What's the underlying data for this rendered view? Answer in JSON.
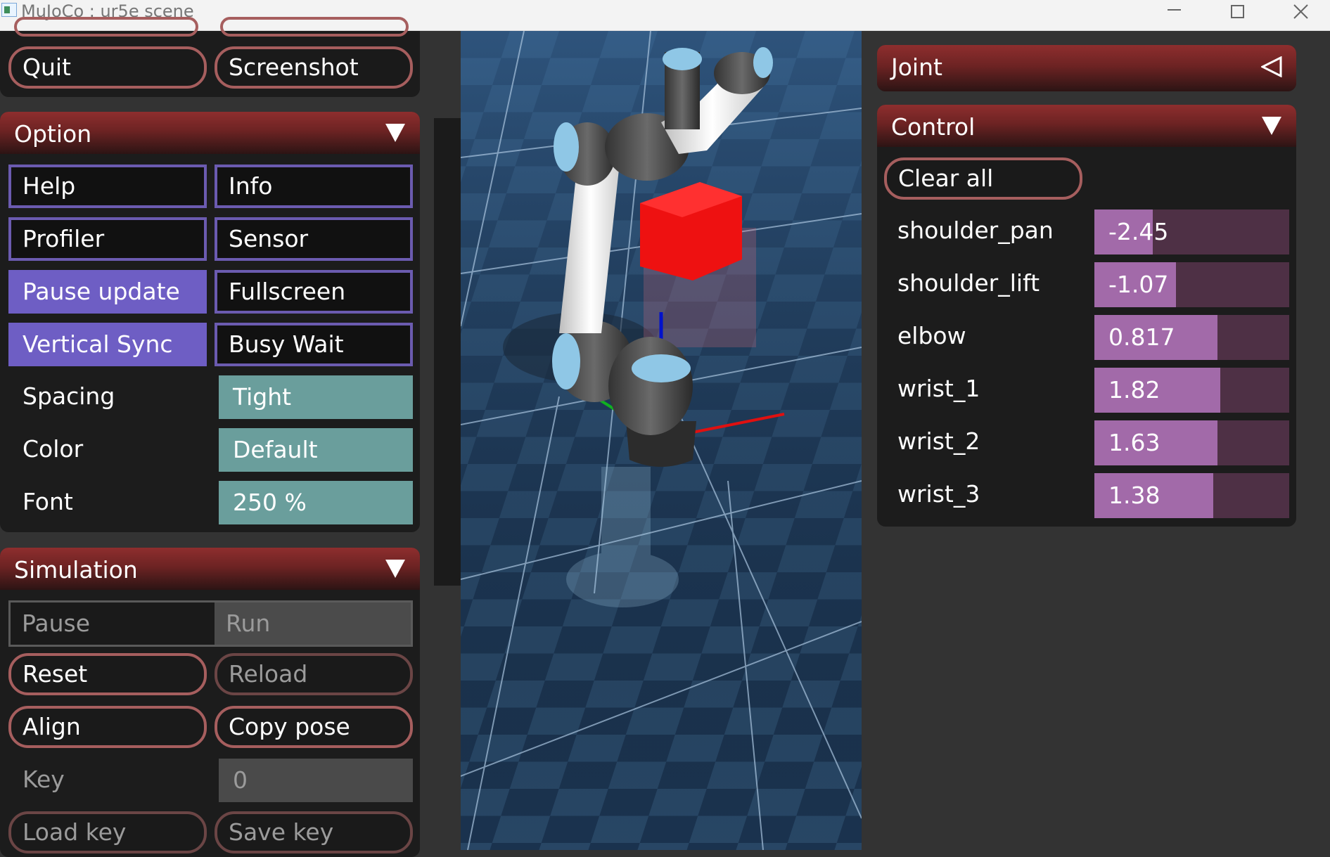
{
  "window": {
    "title": "MuJoCo : ur5e scene"
  },
  "top_buttons": {
    "quit": "Quit",
    "screenshot": "Screenshot"
  },
  "option": {
    "title": "Option",
    "buttons": {
      "help": "Help",
      "info": "Info",
      "profiler": "Profiler",
      "sensor": "Sensor",
      "pause_update": "Pause update",
      "fullscreen": "Fullscreen",
      "vertical_sync": "Vertical Sync",
      "busy_wait": "Busy Wait"
    },
    "spacing_label": "Spacing",
    "spacing_value": "Tight",
    "color_label": "Color",
    "color_value": "Default",
    "font_label": "Font",
    "font_value": "250 %"
  },
  "simulation": {
    "title": "Simulation",
    "pause": "Pause",
    "run": "Run",
    "reset": "Reset",
    "reload": "Reload",
    "align": "Align",
    "copy_pose": "Copy pose",
    "key_label": "Key",
    "key_value": "0",
    "load_key": "Load key",
    "save_key": "Save key"
  },
  "joint": {
    "title": "Joint"
  },
  "control": {
    "title": "Control",
    "clear_all": "Clear all",
    "joints": [
      {
        "name": "shoulder_pan",
        "value": "-2.45",
        "fill": 0.3
      },
      {
        "name": "shoulder_lift",
        "value": "-1.07",
        "fill": 0.42
      },
      {
        "name": "elbow",
        "value": "0.817",
        "fill": 0.63
      },
      {
        "name": "wrist_1",
        "value": "1.82",
        "fill": 0.645
      },
      {
        "name": "wrist_2",
        "value": "1.63",
        "fill": 0.63
      },
      {
        "name": "wrist_3",
        "value": "1.38",
        "fill": 0.61
      }
    ]
  },
  "colors": {
    "header": "#7a2828",
    "accent_purple": "#6e5ec4",
    "teal": "#6a9e9c",
    "slider_fill": "#a26aa9",
    "pill_border": "#a65e5e"
  }
}
